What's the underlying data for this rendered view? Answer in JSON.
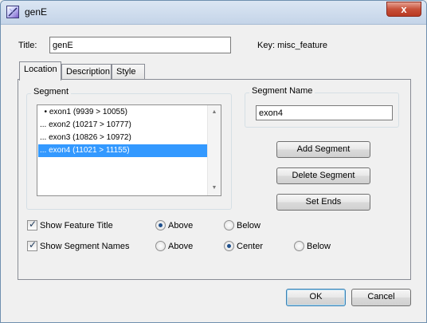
{
  "window": {
    "title": "genE",
    "close_glyph": "x",
    "app_icon": "feature-edit-icon"
  },
  "header": {
    "title_label": "Title:",
    "title_value": "genE",
    "key_text": "Key: misc_feature"
  },
  "tabs": [
    {
      "label": "Location",
      "active": true
    },
    {
      "label": "Description",
      "active": false
    },
    {
      "label": "Style",
      "active": false
    }
  ],
  "segment_group": {
    "title": "Segment",
    "items": [
      {
        "text": "  • exon1 (9939 > 10055)",
        "selected": false
      },
      {
        "text": "... exon2 (10217 > 10777)",
        "selected": false
      },
      {
        "text": "... exon3 (10826 > 10972)",
        "selected": false
      },
      {
        "text": "... exon4 (11021 > 11155)",
        "selected": true
      }
    ]
  },
  "segment_name": {
    "title": "Segment Name",
    "value": "exon4"
  },
  "buttons": {
    "add_segment": "Add Segment",
    "delete_segment": "Delete Segment",
    "set_ends": "Set Ends",
    "ok": "OK",
    "cancel": "Cancel"
  },
  "options": {
    "show_feature_title": {
      "label": "Show Feature Title",
      "checked": true
    },
    "feature_title_above": {
      "label": "Above",
      "selected": true
    },
    "feature_title_below": {
      "label": "Below",
      "selected": false
    },
    "show_segment_names": {
      "label": "Show Segment Names",
      "checked": true
    },
    "segment_names_above": {
      "label": "Above",
      "selected": false
    },
    "segment_names_center": {
      "label": "Center",
      "selected": true
    },
    "segment_names_below": {
      "label": "Below",
      "selected": false
    }
  },
  "colors": {
    "selection": "#3399ff",
    "accent_border": "#3c7fb1"
  }
}
